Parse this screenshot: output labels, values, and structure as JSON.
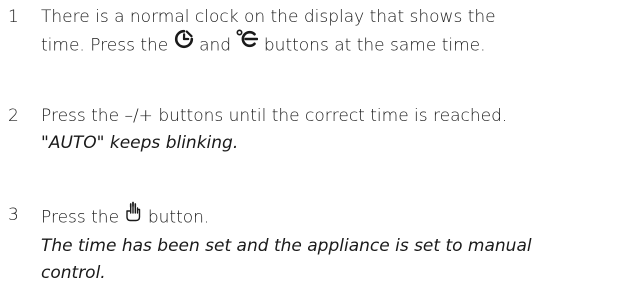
{
  "steps": [
    {
      "number": "1",
      "line1": "There is a normal clock on the display that shows the",
      "line2_before": "time. Press the",
      "icon_a": "clock-timer-icon",
      "line2_middle": "and",
      "icon_b": "temperature-fan-icon",
      "line2_after": "buttons at the same time."
    },
    {
      "number": "2",
      "line1": "Press the –/+ buttons until the correct time is reached.",
      "note": "\"AUTO\" keeps blinking."
    },
    {
      "number": "3",
      "line1_before": "Press the",
      "icon": "hand-manual-icon",
      "line1_after": "button.",
      "note_line1": "The time has been set and the appliance is set to manual",
      "note_line2": "control."
    }
  ]
}
